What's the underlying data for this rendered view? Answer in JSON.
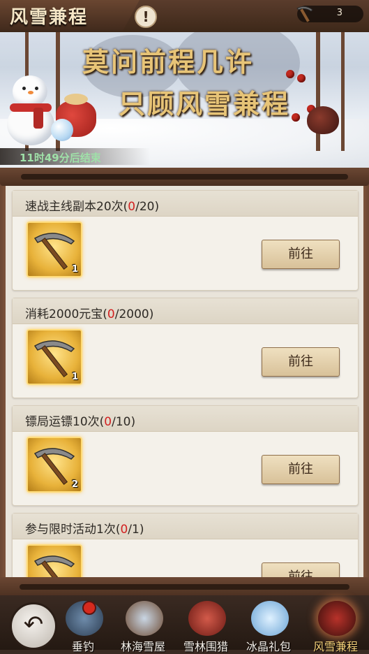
{
  "header": {
    "title": "风雪兼程",
    "info_icon": "exclamation-icon",
    "pickaxe_count": "3",
    "slogan_line1": "莫问前程几许",
    "slogan_line2": "只顾风雪兼程",
    "countdown": "11时49分后结束"
  },
  "tasks": [
    {
      "name": "速战主线副本20次(",
      "current": "0",
      "target": "/20)",
      "reward_icon": "pickaxe-icon",
      "reward_qty": "1",
      "button": "前往"
    },
    {
      "name": "消耗2000元宝(",
      "current": "0",
      "target": "/2000)",
      "reward_icon": "pickaxe-icon",
      "reward_qty": "1",
      "button": "前往"
    },
    {
      "name": "镖局运镖10次(",
      "current": "0",
      "target": "/10)",
      "reward_icon": "pickaxe-icon",
      "reward_qty": "2",
      "button": "前往"
    },
    {
      "name": "参与限时活动1次(",
      "current": "0",
      "target": "/1)",
      "reward_icon": "pickaxe-icon",
      "reward_qty": "",
      "button": "前往"
    }
  ],
  "nav": {
    "back_icon": "back-arrow-icon",
    "items": [
      {
        "label": "垂钓",
        "icon": "fishing-rod-icon",
        "has_alert": true
      },
      {
        "label": "林海雪屋",
        "icon": "snow-house-icon"
      },
      {
        "label": "雪林围猎",
        "icon": "hunting-bag-icon"
      },
      {
        "label": "冰晶礼包",
        "icon": "ice-crystal-icon"
      },
      {
        "label": "风雪兼程",
        "icon": "lantern-icon",
        "active": true
      }
    ]
  },
  "colors": {
    "progress_current": "#d22020",
    "accent_gold": "#e7c477",
    "frame_brown": "#6b4733"
  }
}
